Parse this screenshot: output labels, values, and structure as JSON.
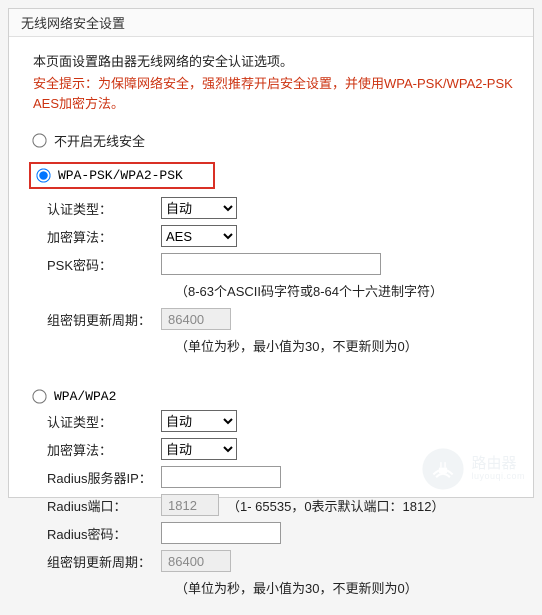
{
  "header": {
    "title": "无线网络安全设置"
  },
  "intro": "本页面设置路由器无线网络的安全认证选项。",
  "warning": "安全提示：为保障网络安全，强烈推荐开启安全设置，并使用WPA-PSK/WPA2-PSK AES加密方法。",
  "radio_none": {
    "label": "不开启无线安全",
    "checked": false
  },
  "radio_wpapsk": {
    "label": "WPA-PSK/WPA2-PSK",
    "checked": true
  },
  "wpapsk": {
    "auth_label": "认证类型：",
    "auth_value": "自动",
    "enc_label": "加密算法：",
    "enc_value": "AES",
    "psk_label": "PSK密码：",
    "psk_value": "",
    "psk_hint": "（8-63个ASCII码字符或8-64个十六进制字符）",
    "rekey_label": "组密钥更新周期：",
    "rekey_value": "86400",
    "rekey_hint": "（单位为秒，最小值为30，不更新则为0）"
  },
  "radio_wpa": {
    "label": "WPA/WPA2",
    "checked": false
  },
  "wpa": {
    "auth_label": "认证类型：",
    "auth_value": "自动",
    "enc_label": "加密算法：",
    "enc_value": "自动",
    "radius_ip_label": "Radius服务器IP：",
    "radius_ip_value": "",
    "radius_port_label": "Radius端口：",
    "radius_port_value": "1812",
    "radius_port_hint": "（1- 65535，0表示默认端口：1812）",
    "radius_pw_label": "Radius密码：",
    "radius_pw_value": "",
    "rekey_label": "组密钥更新周期：",
    "rekey_value": "86400",
    "rekey_hint": "（单位为秒，最小值为30，不更新则为0）"
  },
  "watermark": {
    "text": "路由器",
    "sub": "luyouqi.com"
  }
}
